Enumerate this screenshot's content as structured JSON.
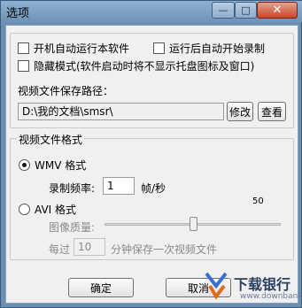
{
  "window": {
    "title": "选项"
  },
  "titlebar": {
    "min_glyph": "—",
    "max_glyph": "□",
    "close_glyph": "✕"
  },
  "general": {
    "autostart_label": "开机自动运行本软件",
    "autostart_checked": false,
    "autorecord_label": "运行后自动开始录制",
    "autorecord_checked": false,
    "hidden_label": "隐藏模式(软件启动时将不显示托盘图标及窗口)",
    "hidden_checked": false,
    "save_path_label": "视频文件保存路径：",
    "save_path_value": "D:\\我的文档\\smsr\\",
    "modify_button": "修改",
    "view_button": "查看"
  },
  "format": {
    "legend": "视频文件格式",
    "wmv_label": "WMV 格式",
    "wmv_selected": true,
    "rate_label": "录制频率:",
    "rate_value": "1",
    "rate_unit": "帧/秒",
    "avi_label": "AVI 格式",
    "avi_selected": false,
    "quality_label": "图像质量:",
    "quality_value_label": "50",
    "quality_fraction": 0.5,
    "every_label": "每过",
    "split_minutes": "10",
    "split_suffix": "分钟保存一次视频文件"
  },
  "footer": {
    "ok_button": "确定",
    "cancel_button": "取消"
  },
  "watermark": {
    "brand": "下载银行",
    "domain": "www.downbank.cn"
  }
}
